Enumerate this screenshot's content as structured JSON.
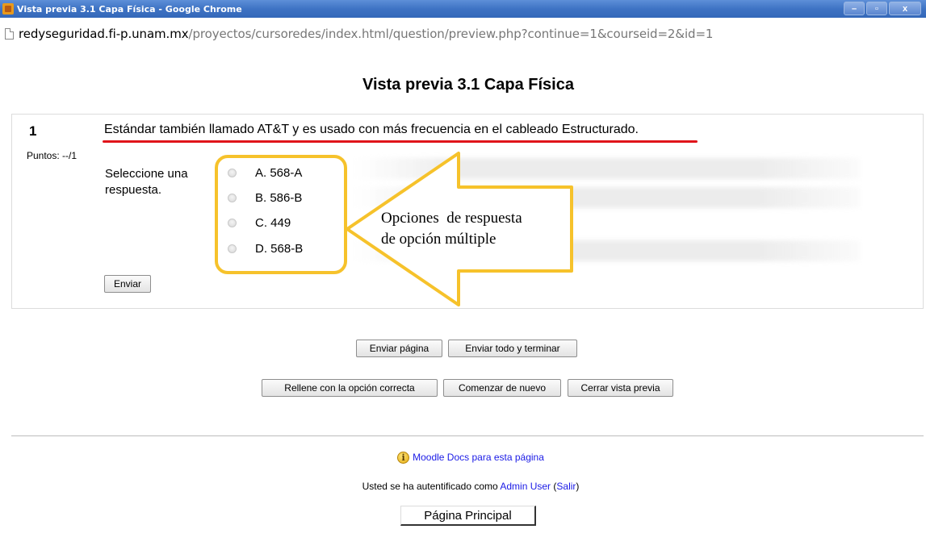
{
  "window": {
    "title": "Vista previa 3.1 Capa Física - Google Chrome",
    "minimize": "–",
    "maximize": "▫",
    "close": "x"
  },
  "address": {
    "host": "redyseguridad.fi-p.unam.mx",
    "path": "/proyectos/cursoredes/index.html/question/preview.php?continue=1&courseid=2&id=1"
  },
  "page": {
    "title": "Vista previa 3.1 Capa Física"
  },
  "question": {
    "number": "1",
    "points": "Puntos: --/1",
    "text": "Estándar también llamado AT&T y es usado con más frecuencia en el cableado Estructurado.",
    "prompt": "Seleccione una respuesta.",
    "options": [
      {
        "label": "A. 568-A"
      },
      {
        "label": "B. 586-B"
      },
      {
        "label": "C. 449"
      },
      {
        "label": "D. 568-B"
      }
    ],
    "submit_label": "Enviar"
  },
  "annotation": {
    "line1": "Opciones  de respuesta",
    "line2": "de opción múltiple",
    "border_color": "#f6c22b",
    "underline_color": "#e0141a"
  },
  "buttons": {
    "submit_page": "Enviar página",
    "submit_all": "Enviar todo y terminar",
    "fill_correct": "Rellene con la opción correcta",
    "restart": "Comenzar de nuevo",
    "close_preview": "Cerrar vista previa"
  },
  "footer": {
    "docs_icon": "i",
    "docs_link": "Moodle Docs para esta página",
    "login_prefix": "Usted se ha autentificado como ",
    "user_link": "Admin User",
    "open_paren": " (",
    "logout_link": "Salir",
    "close_paren": ")",
    "main_page": "Página Principal"
  }
}
